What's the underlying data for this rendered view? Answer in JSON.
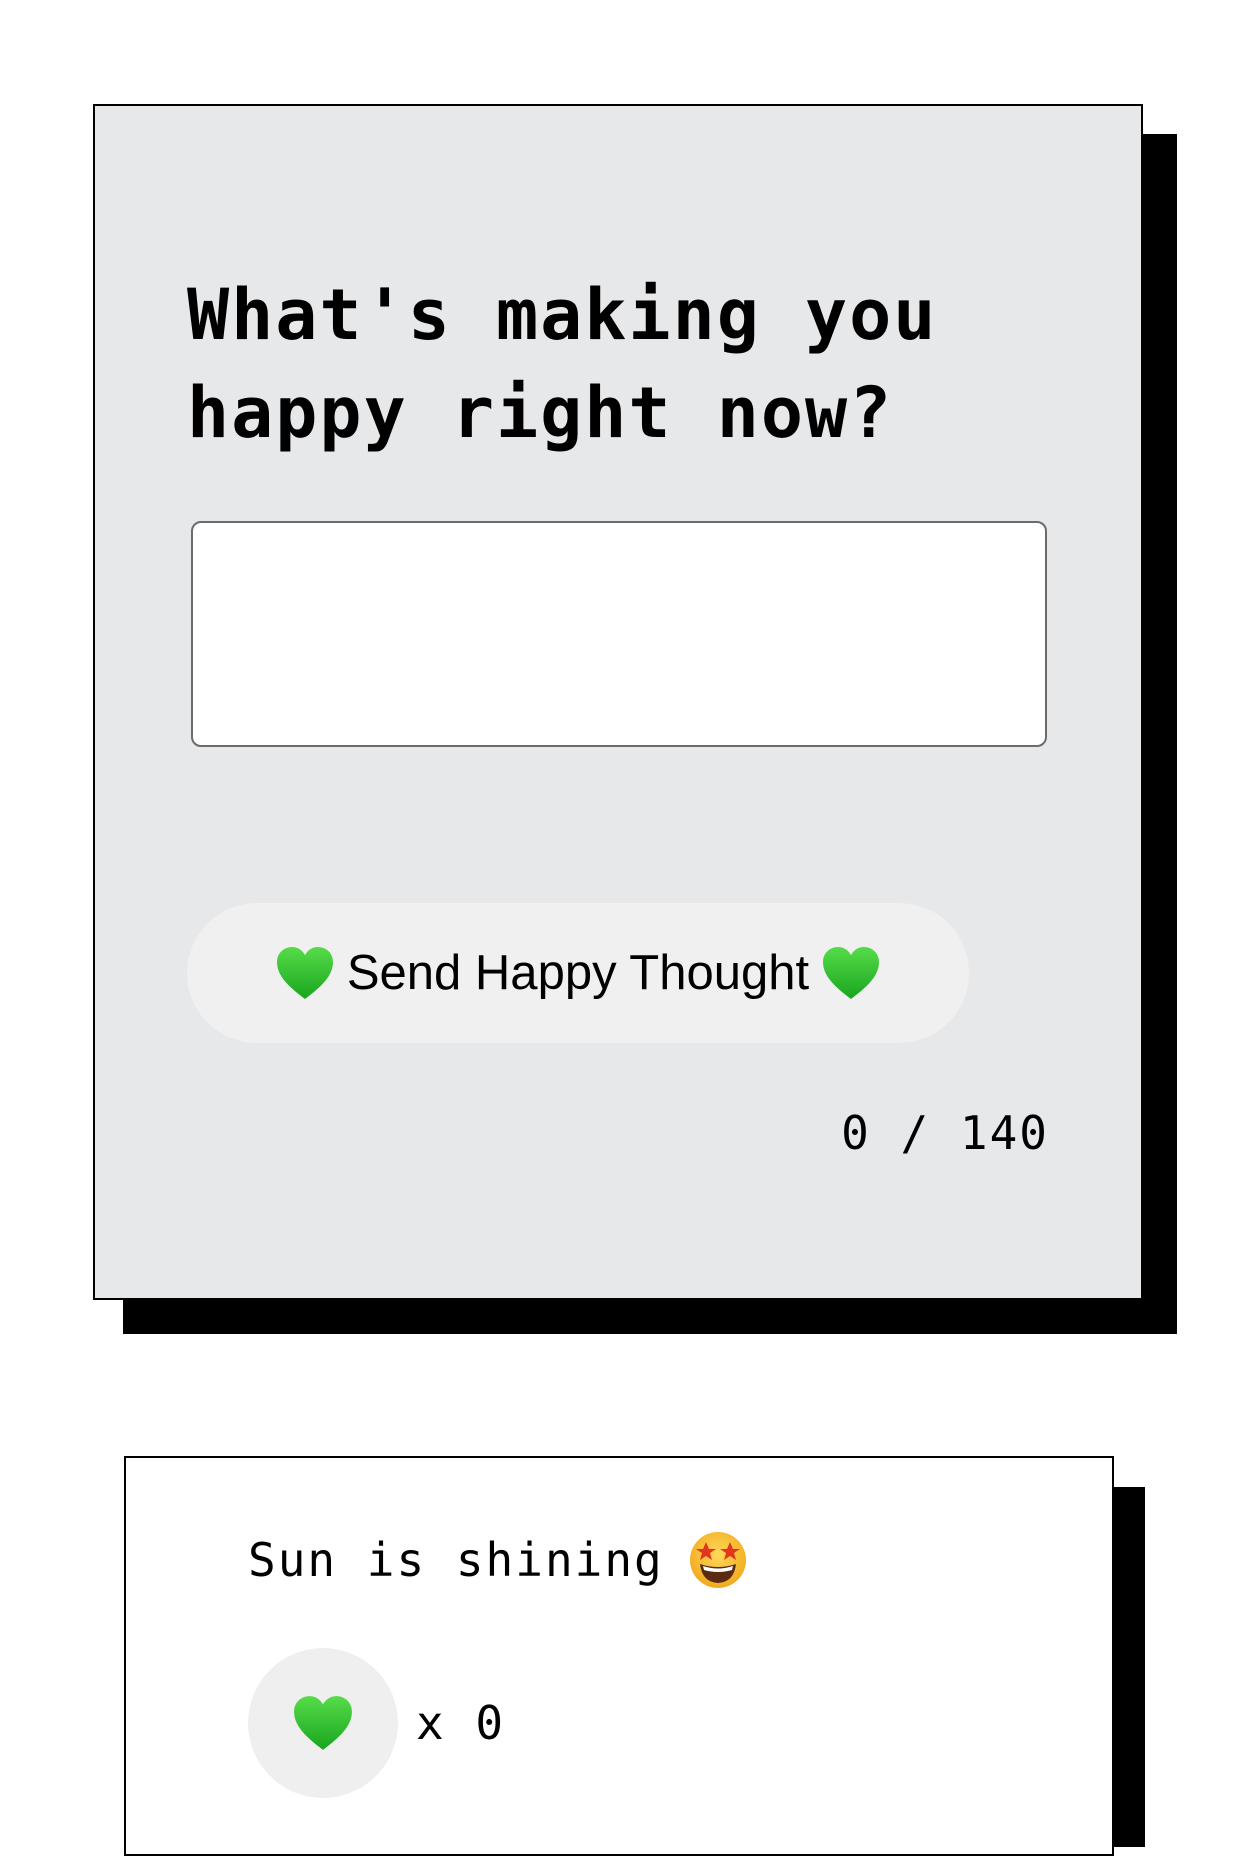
{
  "form": {
    "title": "What's making you happy right now?",
    "input_value": "",
    "button_label": "Send Happy Thought",
    "button_icon": "green-heart-icon",
    "counter": "0 / 140"
  },
  "thoughts": [
    {
      "message": "Sun is shining",
      "emoji": "star-struck-emoji-icon",
      "like_icon": "green-heart-icon",
      "likes": "x 0"
    }
  ],
  "colors": {
    "form_background": "#e7e8ea",
    "button_background": "#f1f0f0",
    "like_button_background": "#efefef",
    "heart": "#2fc22f",
    "shadow": "#000000"
  }
}
